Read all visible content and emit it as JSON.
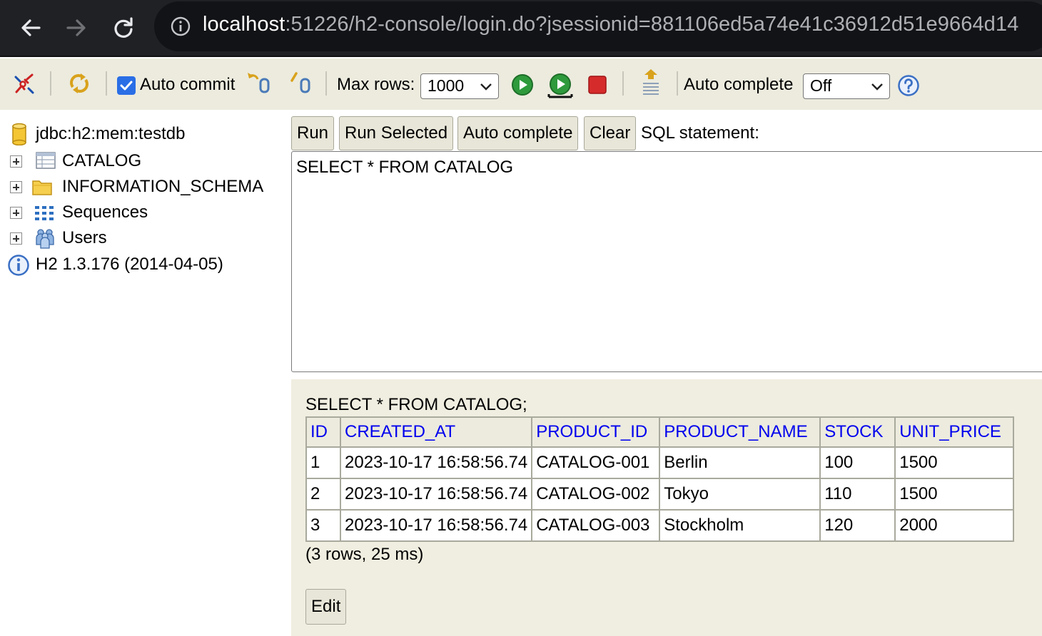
{
  "browser": {
    "url_host": "localhost",
    "url_rest": ":51226/h2-console/login.do?jsessionid=881106ed5a74e41c36912d51e9664d14"
  },
  "toolbar": {
    "auto_commit_label": "Auto commit",
    "auto_commit_checked": true,
    "max_rows_label": "Max rows:",
    "max_rows_value": "1000",
    "auto_complete_label": "Auto complete",
    "auto_complete_value": "Off",
    "accent_color": "#2a6ee6"
  },
  "tree": {
    "connection": "jdbc:h2:mem:testdb",
    "nodes": [
      {
        "label": "CATALOG",
        "icon": "table-icon"
      },
      {
        "label": "INFORMATION_SCHEMA",
        "icon": "folder-icon"
      },
      {
        "label": "Sequences",
        "icon": "sequences-icon"
      },
      {
        "label": "Users",
        "icon": "users-icon"
      }
    ],
    "version": "H2 1.3.176 (2014-04-05)"
  },
  "query": {
    "buttons": [
      "Run",
      "Run Selected",
      "Auto complete",
      "Clear"
    ],
    "sql_label": "SQL statement:",
    "sql_text": "SELECT * FROM CATALOG"
  },
  "results": {
    "statement": "SELECT * FROM CATALOG;",
    "columns": [
      "ID",
      "CREATED_AT",
      "PRODUCT_ID",
      "PRODUCT_NAME",
      "STOCK",
      "UNIT_PRICE"
    ],
    "rows": [
      [
        "1",
        "2023-10-17 16:58:56.74",
        "CATALOG-001",
        "Berlin",
        "100",
        "1500"
      ],
      [
        "2",
        "2023-10-17 16:58:56.74",
        "CATALOG-002",
        "Tokyo",
        "110",
        "1500"
      ],
      [
        "3",
        "2023-10-17 16:58:56.74",
        "CATALOG-003",
        "Stockholm",
        "120",
        "2000"
      ]
    ],
    "summary": "(3 rows, 25 ms)",
    "edit_label": "Edit",
    "header_link_color": "#0000ee"
  }
}
